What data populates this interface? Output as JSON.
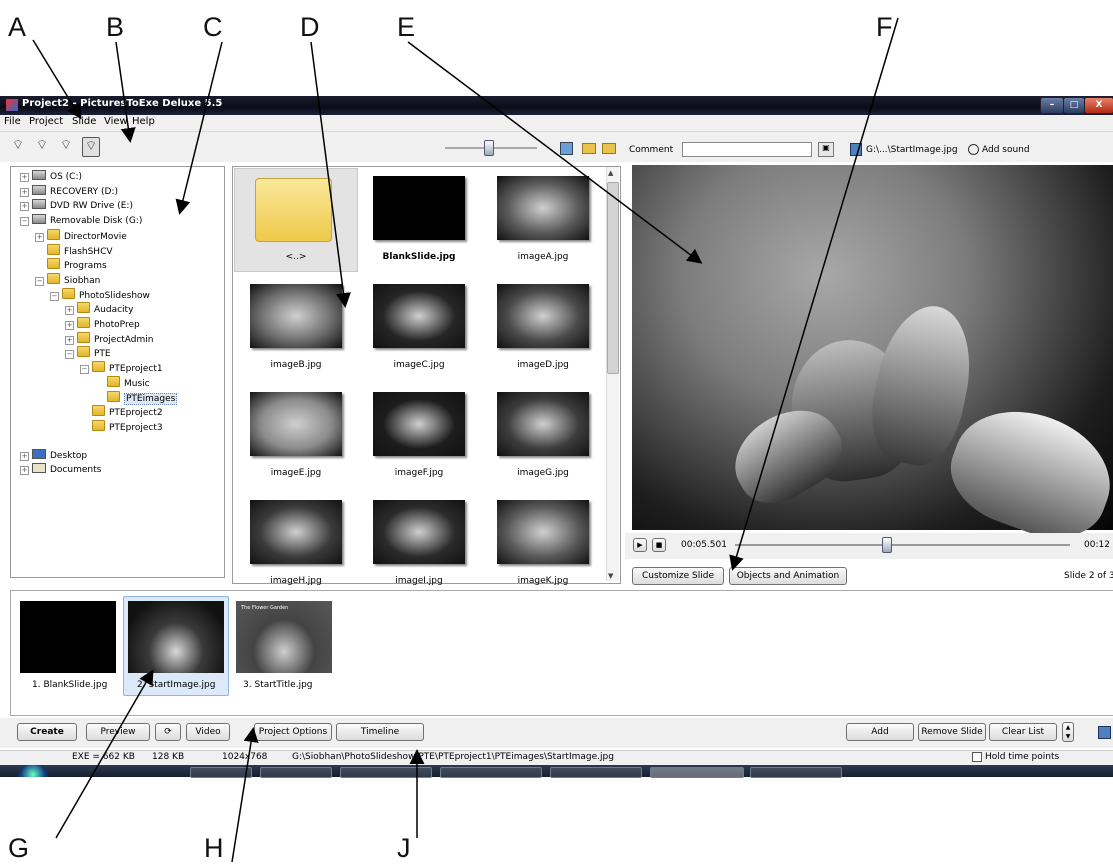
{
  "callouts": [
    "A",
    "B",
    "C",
    "D",
    "E",
    "F",
    "G",
    "H",
    "J"
  ],
  "window": {
    "title": "Project2 - PicturesToExe Deluxe 5.5",
    "minimize": "–",
    "maximize": "□",
    "close": "X"
  },
  "menu": [
    "File",
    "Project",
    "Slide",
    "View",
    "Help"
  ],
  "toolbar": {
    "comment_label": "Comment",
    "image_path": "G:\\...\\StartImage.jpg",
    "add_sound": "Add sound"
  },
  "tree": [
    {
      "label": "OS (C:)",
      "type": "drive",
      "indent": 0,
      "exp": "+"
    },
    {
      "label": "RECOVERY (D:)",
      "type": "drive",
      "indent": 0,
      "exp": "+"
    },
    {
      "label": "DVD RW Drive (E:)",
      "type": "drive",
      "indent": 0,
      "exp": "+"
    },
    {
      "label": "Removable Disk (G:)",
      "type": "drive",
      "indent": 0,
      "exp": "−"
    },
    {
      "label": "DirectorMovie",
      "type": "folder",
      "indent": 1,
      "exp": "+"
    },
    {
      "label": "FlashSHCV",
      "type": "folder",
      "indent": 1,
      "exp": ""
    },
    {
      "label": "Programs",
      "type": "folder",
      "indent": 1,
      "exp": ""
    },
    {
      "label": "Siobhan",
      "type": "folder",
      "indent": 1,
      "exp": "−"
    },
    {
      "label": "PhotoSlideshow",
      "type": "folder",
      "indent": 2,
      "exp": "−"
    },
    {
      "label": "Audacity",
      "type": "folder",
      "indent": 3,
      "exp": "+"
    },
    {
      "label": "PhotoPrep",
      "type": "folder",
      "indent": 3,
      "exp": "+"
    },
    {
      "label": "ProjectAdmin",
      "type": "folder",
      "indent": 3,
      "exp": "+"
    },
    {
      "label": "PTE",
      "type": "folder",
      "indent": 3,
      "exp": "−"
    },
    {
      "label": "PTEproject1",
      "type": "folder",
      "indent": 4,
      "exp": "−"
    },
    {
      "label": "Music",
      "type": "folder",
      "indent": 5,
      "exp": ""
    },
    {
      "label": "PTEimages",
      "type": "folder",
      "indent": 5,
      "exp": "",
      "selected": true
    },
    {
      "label": "PTEproject2",
      "type": "folder",
      "indent": 4,
      "exp": ""
    },
    {
      "label": "PTEproject3",
      "type": "folder",
      "indent": 4,
      "exp": ""
    },
    {
      "label": "Desktop",
      "type": "desktop",
      "indent": 0,
      "exp": "+",
      "gap": true
    },
    {
      "label": "Documents",
      "type": "docs",
      "indent": 0,
      "exp": "+"
    }
  ],
  "thumbnails": [
    {
      "label": "<..>",
      "kind": "folder"
    },
    {
      "label": "BlankSlide.jpg",
      "kind": "black",
      "bold": true
    },
    {
      "label": "imageA.jpg",
      "kind": "photo"
    },
    {
      "label": "imageB.jpg",
      "kind": "photo"
    },
    {
      "label": "imageC.jpg",
      "kind": "photo"
    },
    {
      "label": "imageD.jpg",
      "kind": "photo"
    },
    {
      "label": "imageE.jpg",
      "kind": "photo"
    },
    {
      "label": "imageF.jpg",
      "kind": "photo"
    },
    {
      "label": "imageG.jpg",
      "kind": "photo"
    },
    {
      "label": "imageH.jpg",
      "kind": "photo"
    },
    {
      "label": "imageI.jpg",
      "kind": "photo"
    },
    {
      "label": "imageK.jpg",
      "kind": "photo"
    }
  ],
  "player": {
    "current_time": "00:05.501",
    "end_time": "00:12",
    "progress": 0.45
  },
  "preview_buttons": {
    "customize": "Customize Slide",
    "objects": "Objects and Animation",
    "slide_counter": "Slide 2 of 3"
  },
  "slides": [
    {
      "label": "1. BlankSlide.jpg",
      "kind": "black"
    },
    {
      "label": "2. StartImage.jpg",
      "kind": "flower",
      "selected": true
    },
    {
      "label": "3. StartTitle.jpg",
      "kind": "title",
      "title_text": "The Flower Garden"
    }
  ],
  "bottom_buttons": {
    "create": "Create",
    "preview": "Preview",
    "video": "Video",
    "project_options": "Project Options",
    "timeline": "Timeline",
    "add": "Add",
    "remove": "Remove Slide",
    "clear": "Clear List"
  },
  "status": {
    "exe_size": "EXE = 662 KB",
    "kb": "128 KB",
    "dims": "1024x768",
    "path": "G:\\Siobhan\\PhotoSlideshow\\PTE\\PTEproject1\\PTEimages\\StartImage.jpg",
    "hold": "Hold time points"
  }
}
